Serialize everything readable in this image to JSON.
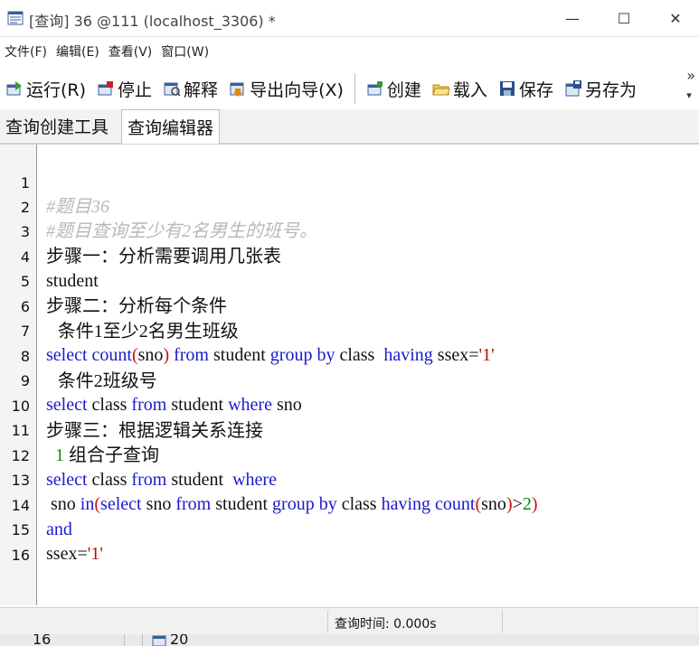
{
  "window": {
    "title": "[查询] 36 @111 (localhost_3306) *",
    "minimize_glyph": "—",
    "maximize_glyph": "☐",
    "close_glyph": "✕"
  },
  "menu": {
    "items": [
      "文件(F)",
      "编辑(E)",
      "查看(V)",
      "窗口(W)"
    ]
  },
  "toolbar": {
    "run": "运行(R)",
    "stop": "停止",
    "explain": "解释",
    "export": "导出向导(X)",
    "create": "创建",
    "load": "载入",
    "save": "保存",
    "save_as": "另存为",
    "more": "»",
    "more_down": "▾",
    "icons": {
      "run": "run-icon",
      "stop": "stop-icon",
      "explain": "explain-icon",
      "export": "export-wizard-icon",
      "create": "create-icon",
      "load": "load-folder-icon",
      "save": "save-disk-icon",
      "save_as": "save-as-icon"
    }
  },
  "tabs": [
    "查询创建工具",
    "查询编辑器"
  ],
  "editor": {
    "line_numbers": [
      "1",
      "2",
      "3",
      "4",
      "5",
      "6",
      "7",
      "8",
      "9",
      "10",
      "11",
      "12",
      "13",
      "14",
      "15",
      "16"
    ],
    "lines": {
      "l1": "#题目36",
      "l2": "#题目查询至少有2名男生的班号。",
      "l3": "步骤一：分析需要调用几张表",
      "l4": "student",
      "l5": "步骤二：分析每个条件",
      "l6a": "  条件",
      "l6b": "1",
      "l6c": "至少",
      "l6d": "2",
      "l6e": "名男生班级",
      "l7a": "select",
      "l7b": " ",
      "l7c": "count",
      "l7d": "(",
      "l7e": "sno",
      "l7f": ")",
      "l7g": " ",
      "l7h": "from",
      "l7i": " student ",
      "l7j": "group by",
      "l7k": " class  ",
      "l7l": "having",
      "l7m": " ssex=",
      "l7n": "'1'",
      "l8a": "  条件",
      "l8b": "2",
      "l8c": "班级号",
      "l9a": "select",
      "l9b": " class ",
      "l9c": "from",
      "l9d": " student ",
      "l9e": "where",
      "l9f": " sno",
      "l10": "步骤三：根据逻辑关系连接",
      "l11a": "  1 ",
      "l11b": "组合子查询",
      "l12a": "select",
      "l12b": " class ",
      "l12c": "from",
      "l12d": " student  ",
      "l12e": "where",
      "l13a": " sno ",
      "l13b": "in",
      "l13c": "(",
      "l13d": "select",
      "l13e": " sno ",
      "l13f": "from",
      "l13g": " student ",
      "l13h": "group by",
      "l13i": " class ",
      "l13j": "having",
      "l13k": " ",
      "l13l": "count",
      "l13m": "(",
      "l13n": "sno",
      "l13o": ")",
      "l13p": ">",
      "l13q": "2",
      "l13r": ")",
      "l14": "and",
      "l15a": "ssex=",
      "l15b": "'1'",
      "l16": ""
    }
  },
  "status": {
    "query_time": "查询时间: 0.000s"
  },
  "background_window": {
    "left_text": "16",
    "right_text": "20"
  },
  "colors": {
    "keyword": "#1a1acc",
    "paren": "#d01010",
    "number": "#0a8a0a",
    "comment": "#b8b8b8"
  }
}
